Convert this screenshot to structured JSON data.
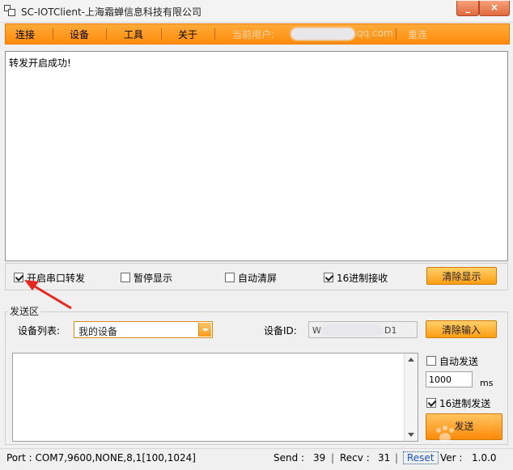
{
  "window": {
    "title": "SC-IOTClient-上海霜蝉信息科技有限公司",
    "minimize_glyph": "_",
    "close_glyph": "×"
  },
  "menu": {
    "items": [
      "连接",
      "设备",
      "工具",
      "关于"
    ],
    "current_user_label": "当前用户:",
    "user_value_visible": "qq.com",
    "retry_label": "重连"
  },
  "log": {
    "lines": [
      "转发开启成功!"
    ]
  },
  "options": {
    "forward_serial": {
      "label": "开启串口转发",
      "checked": true
    },
    "pause_display": {
      "label": "暂停显示",
      "checked": false
    },
    "auto_clear": {
      "label": "自动清屏",
      "checked": false
    },
    "hex_receive": {
      "label": "16进制接收",
      "checked": true
    },
    "clear_display_button": "清除显示"
  },
  "send_area": {
    "group_title": "发送区",
    "device_list_label": "设备列表:",
    "device_selected": "我的设备",
    "device_id_label": "设备ID:",
    "device_id_value_visible_start": "W",
    "device_id_value_visible_end": "D1",
    "clear_input_button": "清除输入",
    "auto_send": {
      "label": "自动发送",
      "checked": false
    },
    "interval_value": "1000",
    "interval_unit": "ms",
    "hex_send": {
      "label": "16进制发送",
      "checked": true
    },
    "send_button": "发送"
  },
  "status": {
    "port": "Port : COM7,9600,NONE,8,1[100,1024]",
    "send_label": "Send :",
    "send_value": "39",
    "recv_label": "Recv :",
    "recv_value": "31",
    "reset_label": "Reset",
    "ver_label": "Ver :",
    "ver_value": "1.0.0"
  },
  "colors": {
    "accent_orange": "#ff9a1a",
    "annotation_red": "#e8281e",
    "reset_blue": "#1d4fc7"
  }
}
